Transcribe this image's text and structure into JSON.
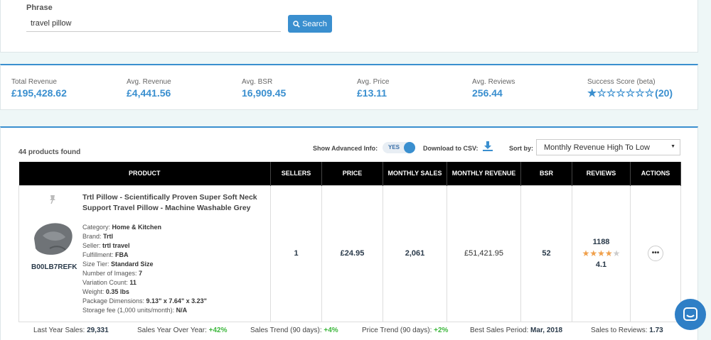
{
  "search": {
    "label": "Phrase",
    "value": "travel pillow",
    "button_label": "Search"
  },
  "stats": [
    {
      "label": "Total Revenue",
      "value": "£195,428.62"
    },
    {
      "label": "Avg. Revenue",
      "value": "£4,441.56"
    },
    {
      "label": "Avg. BSR",
      "value": "16,909.45"
    },
    {
      "label": "Avg. Price",
      "value": "£13.11"
    },
    {
      "label": "Avg. Reviews",
      "value": "256.44"
    }
  ],
  "success_score": {
    "label": "Success Score (beta)",
    "value": "(20)",
    "stars_filled": 1,
    "stars_total": 7
  },
  "results": {
    "found": "44 products found",
    "advanced_label": "Show Advanced Info:",
    "advanced_value": "YES",
    "csv_label": "Download to CSV:",
    "sort_label": "Sort by:",
    "sort_value": "Monthly Revenue High To Low"
  },
  "columns": [
    "PRODUCT",
    "SELLERS",
    "PRICE",
    "MONTHLY SALES",
    "MONTHLY REVENUE",
    "BSR",
    "REVIEWS",
    "ACTIONS"
  ],
  "product": {
    "title": "Trtl Pillow - Scientifically Proven Super Soft Neck Support Travel Pillow - Machine Washable Grey",
    "asin": "B00LB7REFK",
    "details": [
      {
        "k": "Category: ",
        "v": "Home & Kitchen"
      },
      {
        "k": "Brand: ",
        "v": "Trtl"
      },
      {
        "k": "Seller: ",
        "v": "trtl travel"
      },
      {
        "k": "Fulfillment: ",
        "v": "FBA"
      },
      {
        "k": "Size Tier: ",
        "v": "Standard Size"
      },
      {
        "k": "Number of Images: ",
        "v": "7"
      },
      {
        "k": "Variation Count: ",
        "v": "11"
      },
      {
        "k": "Weight: ",
        "v": "0.35 lbs"
      },
      {
        "k": "Package Dimensions: ",
        "v": "9.13\" x 7.64\" x 3.23\""
      },
      {
        "k": "Storage fee (1,000 units/month): ",
        "v": "N/A"
      }
    ],
    "sellers": "1",
    "price": "£24.95",
    "monthly_sales": "2,061",
    "monthly_revenue": "£51,421.95",
    "bsr": "52",
    "reviews": "1188",
    "rating": "4.1",
    "rating_stars": 4,
    "more_label": "•••"
  },
  "summary": [
    {
      "k": "Last Year Sales: ",
      "v": "29,331",
      "up": false
    },
    {
      "k": "Sales Year Over Year: ",
      "v": "+42%",
      "up": true
    },
    {
      "k": "Sales Trend (90 days): ",
      "v": "+4%",
      "up": true
    },
    {
      "k": "Price Trend (90 days): ",
      "v": "+2%",
      "up": true
    },
    {
      "k": "Best Sales Period: ",
      "v": "Mar, 2018",
      "up": false
    },
    {
      "k": "Sales to Reviews: ",
      "v": "1.73",
      "up": false
    }
  ],
  "colors": {
    "accent": "#3a8fcf",
    "positive": "#3db73d",
    "star": "#f0a04b"
  }
}
